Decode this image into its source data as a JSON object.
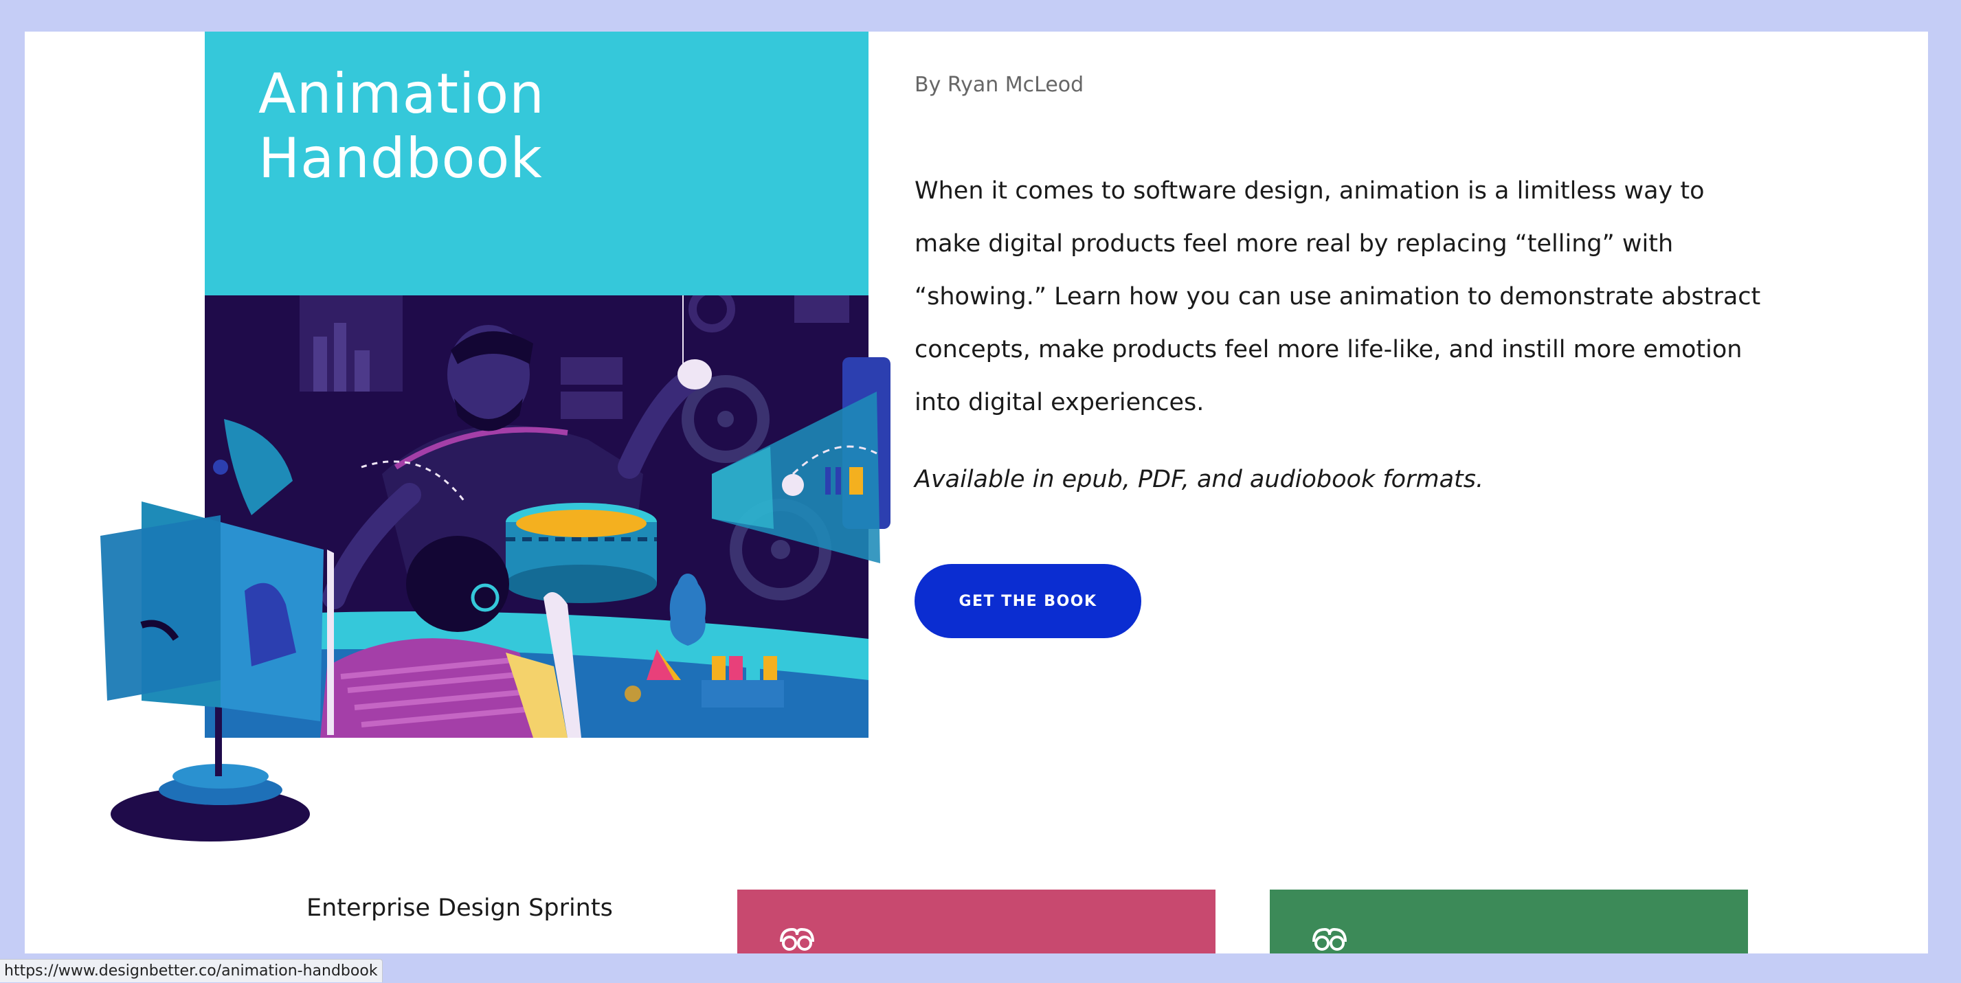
{
  "book": {
    "title_line1": "Animation",
    "title_line2": "Handbook",
    "byline": "By Ryan McLeod",
    "description": "When it comes to software design, animation is a limitless way to make digital products feel more real by replacing “telling” with “showing.” Learn how you can use animation to demonstrate abstract concepts, make products feel more life-like, and instill more emotion into digital experiences.",
    "formats": "Available in epub, PDF, and audiobook formats.",
    "cta_label": "GET THE BOOK"
  },
  "related": {
    "title": "Enterprise Design Sprints",
    "cards": [
      {
        "color": "#c8496f",
        "icon": "owl-icon"
      },
      {
        "color": "#3c8a58",
        "icon": "owl-icon"
      }
    ]
  },
  "status_bar": {
    "url": "https://www.designbetter.co/animation-handbook"
  },
  "colors": {
    "page_frame": "#c5cdf6",
    "cover_teal": "#35c8da",
    "cover_dark": "#1f0b4a",
    "cta_blue": "#0b2dd1"
  }
}
